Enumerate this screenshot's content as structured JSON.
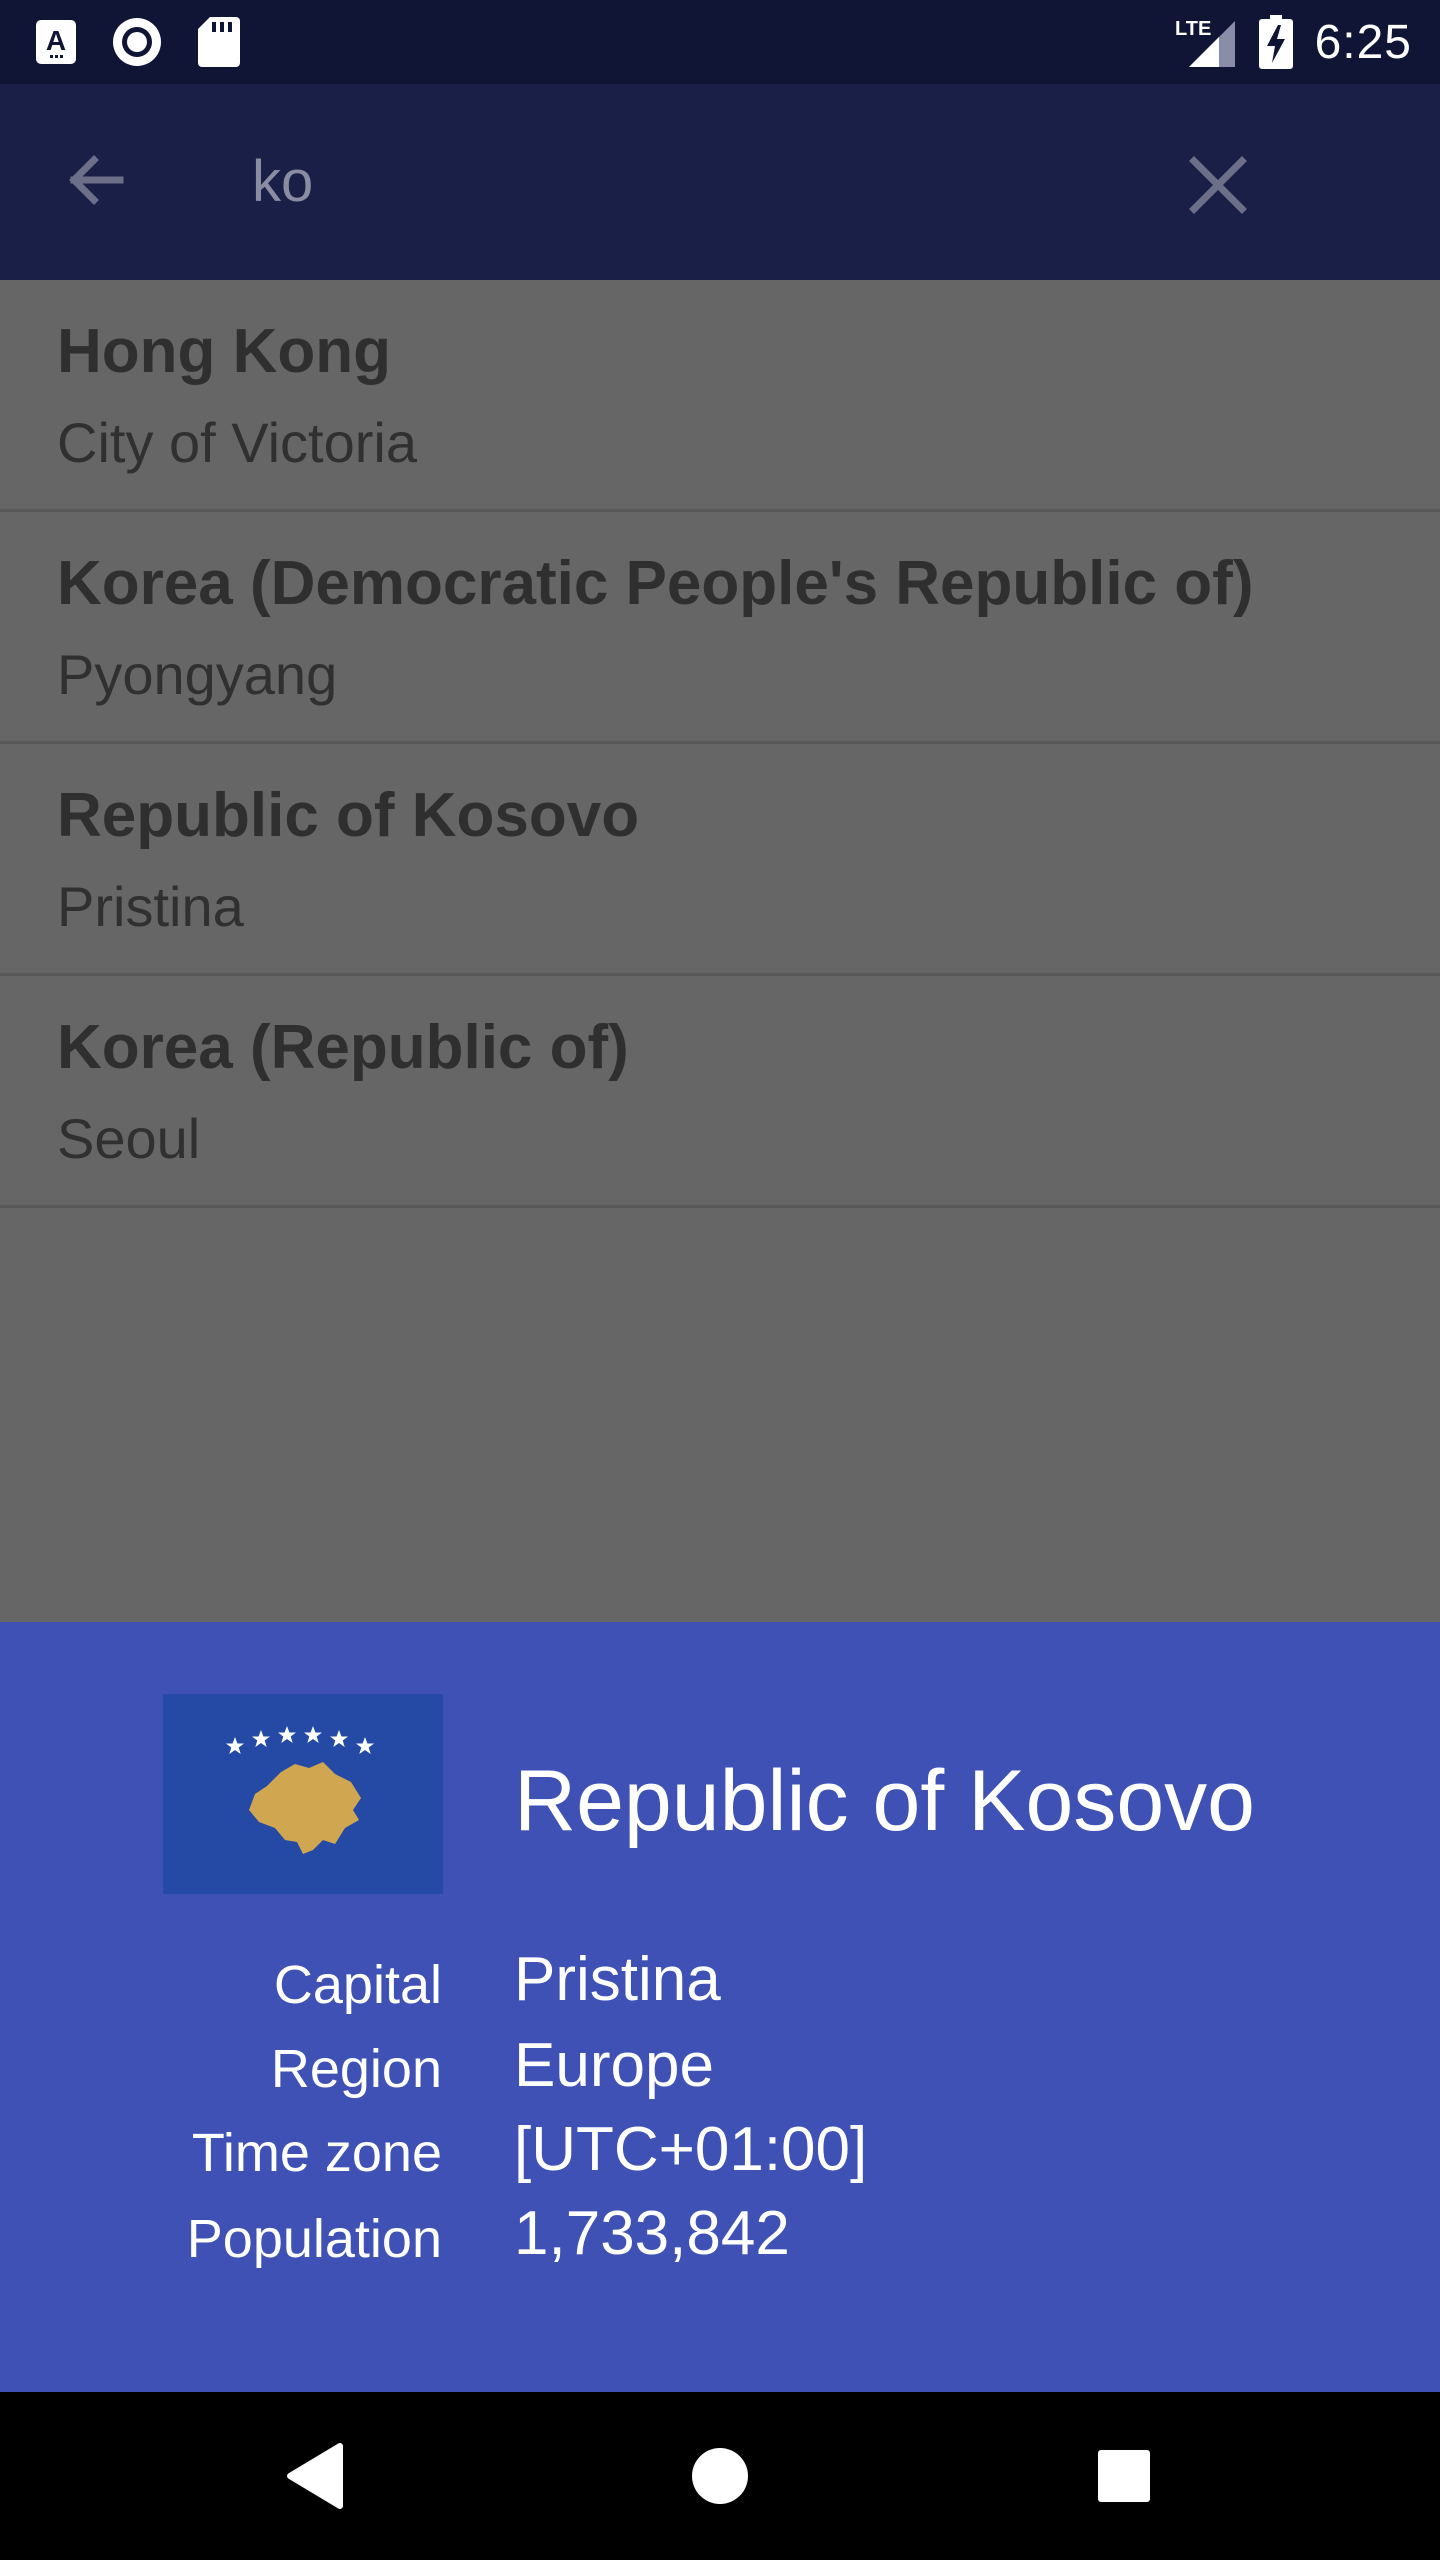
{
  "status_bar": {
    "time": "6:25",
    "network": "LTE",
    "icons": [
      "a-notification-icon",
      "record-icon",
      "sd-card-icon",
      "signal-icon",
      "battery-charging-icon"
    ]
  },
  "search": {
    "value": "ko",
    "icons": [
      "back-arrow-icon",
      "close-icon"
    ]
  },
  "results": [
    {
      "name": "Hong Kong",
      "capital": "City of Victoria"
    },
    {
      "name": "Korea (Democratic People's Republic of)",
      "capital": "Pyongyang"
    },
    {
      "name": "Republic of Kosovo",
      "capital": "Pristina"
    },
    {
      "name": "Korea (Republic of)",
      "capital": "Seoul"
    }
  ],
  "detail": {
    "title": "Republic of Kosovo",
    "flag_icon": "kosovo-flag",
    "fields": [
      {
        "label": "Capital",
        "value": "Pristina"
      },
      {
        "label": "Region",
        "value": "Europe"
      },
      {
        "label": "Time zone",
        "value": "[UTC+01:00]"
      },
      {
        "label": "Population",
        "value": "1,733,842"
      }
    ]
  },
  "nav_bar": {
    "icons": [
      "nav-back-icon",
      "nav-home-icon",
      "nav-recents-icon"
    ]
  },
  "colors": {
    "status_bar": "#111535",
    "app_bar_dimmed": "#1a1f48",
    "scrim_background": "#666666",
    "sheet": "#3f51b5",
    "flag_blue": "#244aa5",
    "flag_gold": "#d0a650"
  }
}
